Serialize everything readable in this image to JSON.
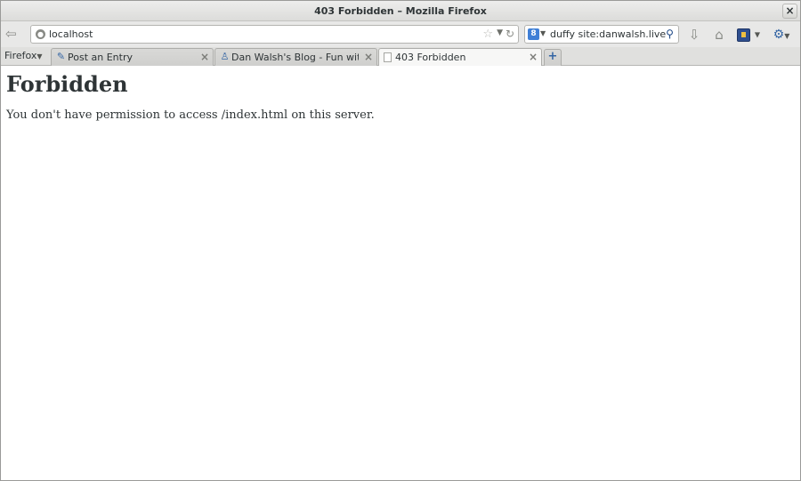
{
  "window": {
    "title": "403 Forbidden – Mozilla Firefox",
    "close_label": "×"
  },
  "navbar": {
    "url": "localhost",
    "search_text": "duffy site:danwalsh.livejournal.com",
    "search_engine_label": "8"
  },
  "menu": {
    "firefox_label": "Firefox"
  },
  "tabs": [
    {
      "label": "Post an Entry",
      "close": "×"
    },
    {
      "label": "Dan Walsh's Blog - Fun with...",
      "close": "×"
    },
    {
      "label": "403 Forbidden",
      "close": "×"
    }
  ],
  "newtab_label": "+",
  "page": {
    "heading": "Forbidden",
    "message": "You don't have permission to access /index.html on this server."
  },
  "icons": {
    "back": "back-arrow-icon",
    "site": "site-identity-icon",
    "bookmark": "star-icon",
    "reload": "reload-icon",
    "download": "download-icon",
    "home": "home-icon",
    "addon": "addon-icon",
    "network": "network-icon"
  }
}
